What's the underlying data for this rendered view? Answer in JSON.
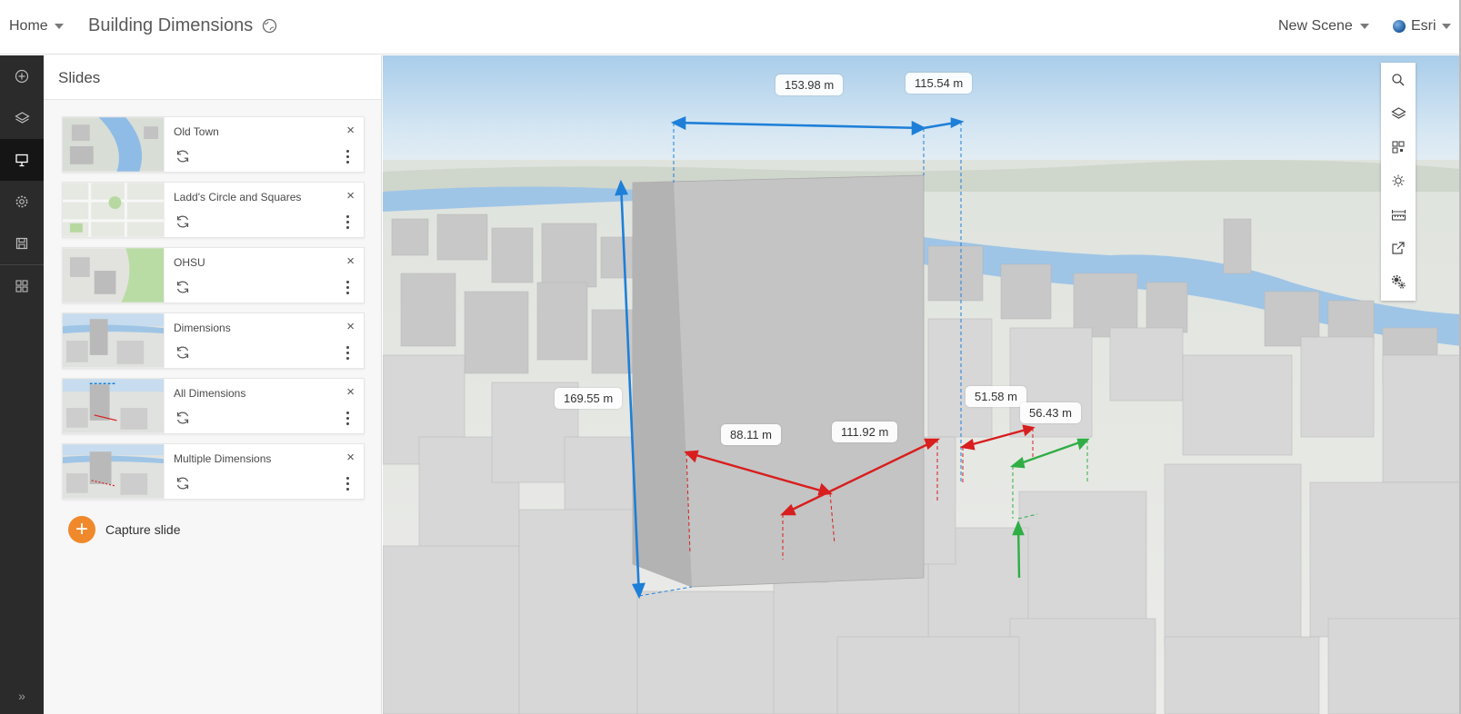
{
  "header": {
    "home_label": "Home",
    "title": "Building Dimensions",
    "new_scene_label": "New Scene",
    "user_label": "Esri"
  },
  "leftbar": {
    "items": [
      {
        "icon": "plus-circle-icon",
        "active": false
      },
      {
        "icon": "layers-icon",
        "active": false
      },
      {
        "icon": "presentation-icon",
        "active": true
      },
      {
        "icon": "gear-icon",
        "active": false
      },
      {
        "icon": "save-icon",
        "active": false
      },
      {
        "icon": "grid-icon",
        "active": false
      }
    ],
    "expand_label": "»"
  },
  "slides_panel": {
    "title": "Slides",
    "slides": [
      {
        "name": "Old Town",
        "thumb": "river"
      },
      {
        "name": "Ladd's Circle and Squares",
        "thumb": "streets"
      },
      {
        "name": "OHSU",
        "thumb": "hills"
      },
      {
        "name": "Dimensions",
        "thumb": "tower"
      },
      {
        "name": "All Dimensions",
        "thumb": "tower-dims"
      },
      {
        "name": "Multiple Dimensions",
        "thumb": "tower-dims2"
      }
    ],
    "close_glyph": "×",
    "capture_label": "Capture slide",
    "capture_glyph": "+"
  },
  "map": {
    "dimensions": [
      {
        "label": "153.98 m",
        "color": "#1e7fd8"
      },
      {
        "label": "115.54 m",
        "color": "#1e7fd8"
      },
      {
        "label": "169.55 m",
        "color": "#1e7fd8"
      },
      {
        "label": "88.11 m",
        "color": "#d81e1e"
      },
      {
        "label": "111.92 m",
        "color": "#d81e1e"
      },
      {
        "label": "51.58 m",
        "color": "#d81e1e"
      },
      {
        "label": "56.43 m",
        "color": "#2fae44"
      }
    ]
  },
  "tools": [
    "search-icon",
    "layers-icon",
    "basemap-icon",
    "daylight-icon",
    "measure-icon",
    "share-icon",
    "settings-icon"
  ],
  "colors": {
    "accent": "#f0892c",
    "blue_dimension": "#1e7fd8",
    "red_dimension": "#d81e1e",
    "green_dimension": "#2fae44",
    "leftbar_bg": "#2b2b2b"
  }
}
